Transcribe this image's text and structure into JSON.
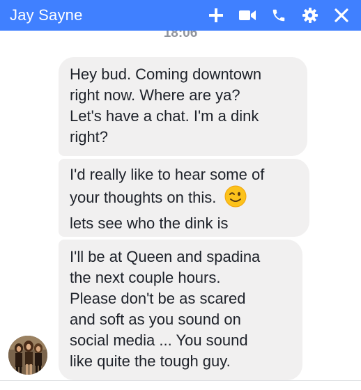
{
  "header": {
    "title": "Jay Sayne",
    "color": "#4080ff",
    "icons": [
      "plus-icon",
      "video-camera-icon",
      "phone-icon",
      "gear-icon",
      "close-icon"
    ]
  },
  "conversation": {
    "timestamp": "18:06",
    "messages": [
      {
        "lines": [
          "Hey bud. Coming downtown",
          "right now. Where are ya?",
          "Let's have a chat.  I'm a dink",
          "right?"
        ]
      },
      {
        "lines": [
          "I'd really like to hear some of",
          "your thoughts on this.",
          "lets see who the dink is"
        ],
        "emoji": "winking-face-emoji"
      },
      {
        "lines": [
          "I'll be at Queen and spadina",
          "the next couple hours.",
          "Please don't be as scared",
          "and soft as you sound on",
          "social media ... You sound",
          "like quite the tough guy."
        ]
      }
    ],
    "bubble_color": "#f1f0f0",
    "sender_avatar": "sender-avatar-photo"
  }
}
